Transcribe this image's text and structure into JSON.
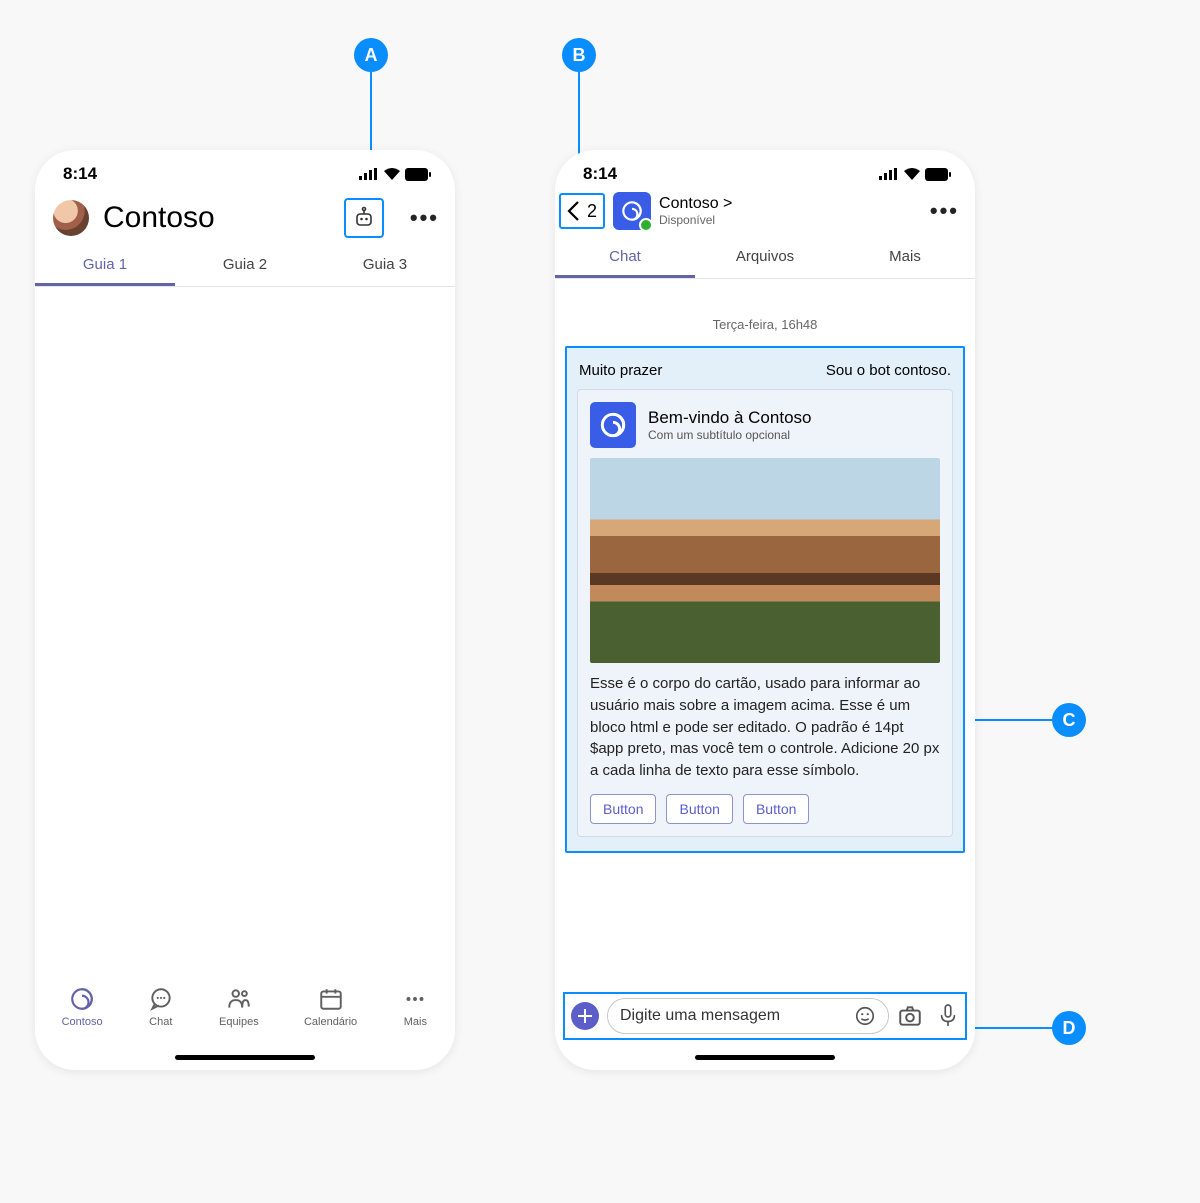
{
  "status": {
    "time": "8:14"
  },
  "callouts": {
    "a": "A",
    "b": "B",
    "c": "C",
    "d": "D"
  },
  "left": {
    "title": "Contoso",
    "tabs": [
      "Guia 1",
      "Guia 2",
      "Guia 3"
    ],
    "nav": {
      "contoso": "Contoso",
      "chat": "Chat",
      "equipes": "Equipes",
      "calendario": "Calendário",
      "mais": "Mais"
    }
  },
  "right": {
    "back_count": "2",
    "bot_name": "Contoso >",
    "bot_status": "Disponível",
    "tabs": [
      "Chat",
      "Arquivos",
      "Mais"
    ],
    "timestamp": "Terça-feira, 16h48",
    "msg_left": "Muito prazer",
    "msg_right": "Sou o bot contoso.",
    "card": {
      "title": "Bem-vindo à Contoso",
      "subtitle": "Com um subtítulo opcional",
      "body": "Esse é o corpo do cartão, usado para informar ao usuário mais sobre a imagem acima. Esse é um bloco html e pode ser editado. O padrão é 14pt $app preto, mas você tem o controle. Adicione 20 px a cada linha de texto para esse símbolo.",
      "buttons": [
        "Button",
        "Button",
        "Button"
      ]
    },
    "compose_placeholder": "Digite uma mensagem"
  }
}
